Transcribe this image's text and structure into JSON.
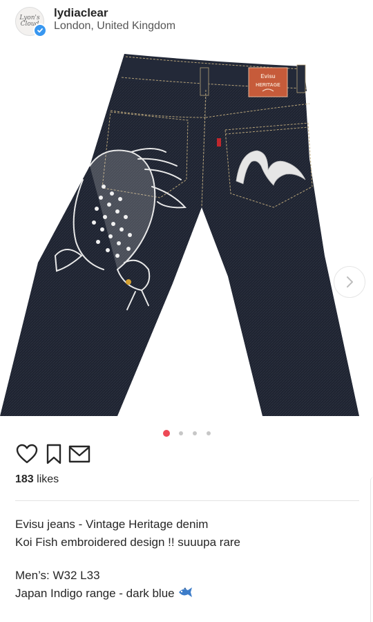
{
  "post": {
    "username": "lydiaclear",
    "location": "London, United Kingdom",
    "avatar_text": "Lyon's Cloud",
    "verified_icon": "verified-badge-icon",
    "photo": {
      "subject": "embroidered-jeans",
      "label_brand": "Evisu",
      "label_line": "HERITAGE"
    },
    "carousel": {
      "count": 4,
      "active": 1
    },
    "actions": [
      "heart-icon",
      "bookmark-icon",
      "envelope-icon"
    ],
    "likes_count": "183",
    "likes_suffix": " likes",
    "caption": {
      "line1": "Evisu jeans - Vintage Heritage denim",
      "line2": "Koi Fish embroidered design !! suuupa rare",
      "line3": "Men’s: W32 L33",
      "line4": "Japan Indigo range - dark blue",
      "emoji_icon": "fish-icon"
    }
  },
  "colors": {
    "accent_dot": "#ed4956",
    "verified": "#3897f0",
    "denim": "#1f2430"
  }
}
